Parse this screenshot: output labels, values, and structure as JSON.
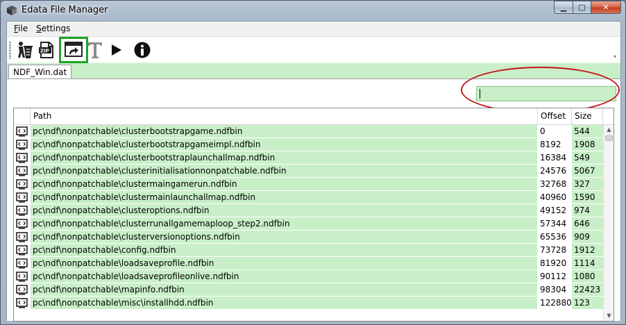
{
  "window": {
    "title": "Edata File Manager",
    "minimize_glyph": "▁",
    "maximize_glyph": "□",
    "close_glyph": "✕"
  },
  "menu": {
    "file": {
      "mnemonic": "F",
      "rest": "ile"
    },
    "settings": {
      "mnemonic": "S",
      "rest": "ettings"
    }
  },
  "toolbar": {
    "buttons": [
      {
        "icon": "recycle-bin-icon"
      },
      {
        "icon": "zip-archive-icon"
      },
      {
        "icon": "export-window-icon",
        "selected": true
      },
      {
        "icon": "text-t-icon"
      },
      {
        "icon": "play-icon"
      },
      {
        "icon": "info-icon"
      }
    ],
    "overflow_glyph": "▾"
  },
  "tab": {
    "label": "NDF_Win.dat"
  },
  "filter": {
    "value": ""
  },
  "table": {
    "headers": {
      "path": "Path",
      "offset": "Offset",
      "size": "Size"
    },
    "rows": [
      {
        "path": "pc\\ndf\\nonpatchable\\clusterbootstrapgame.ndfbin",
        "offset": "0",
        "size": "544"
      },
      {
        "path": "pc\\ndf\\nonpatchable\\clusterbootstrapgameimpl.ndfbin",
        "offset": "8192",
        "size": "1908"
      },
      {
        "path": "pc\\ndf\\nonpatchable\\clusterbootstraplaunchallmap.ndfbin",
        "offset": "16384",
        "size": "549"
      },
      {
        "path": "pc\\ndf\\nonpatchable\\clusterinitialisationnonpatchable.ndfbin",
        "offset": "24576",
        "size": "5067"
      },
      {
        "path": "pc\\ndf\\nonpatchable\\clustermaingamerun.ndfbin",
        "offset": "32768",
        "size": "327"
      },
      {
        "path": "pc\\ndf\\nonpatchable\\clustermainlaunchallmap.ndfbin",
        "offset": "40960",
        "size": "1590"
      },
      {
        "path": "pc\\ndf\\nonpatchable\\clusteroptions.ndfbin",
        "offset": "49152",
        "size": "974"
      },
      {
        "path": "pc\\ndf\\nonpatchable\\clusterrunallgamemaploop_step2.ndfbin",
        "offset": "57344",
        "size": "646"
      },
      {
        "path": "pc\\ndf\\nonpatchable\\clusterversionoptions.ndfbin",
        "offset": "65536",
        "size": "909"
      },
      {
        "path": "pc\\ndf\\nonpatchable\\config.ndfbin",
        "offset": "73728",
        "size": "1912"
      },
      {
        "path": "pc\\ndf\\nonpatchable\\loadsaveprofile.ndfbin",
        "offset": "81920",
        "size": "1114"
      },
      {
        "path": "pc\\ndf\\nonpatchable\\loadsaveprofileonlive.ndfbin",
        "offset": "90112",
        "size": "1080"
      },
      {
        "path": "pc\\ndf\\nonpatchable\\mapinfo.ndfbin",
        "offset": "98304",
        "size": "22423"
      },
      {
        "path": "pc\\ndf\\nonpatchable\\misc\\installhdd.ndfbin",
        "offset": "122880",
        "size": "123"
      }
    ]
  },
  "colors": {
    "row_highlight": "#c9efc9",
    "selection_outline": "#1fa321",
    "annotation_red": "#c4161c"
  }
}
